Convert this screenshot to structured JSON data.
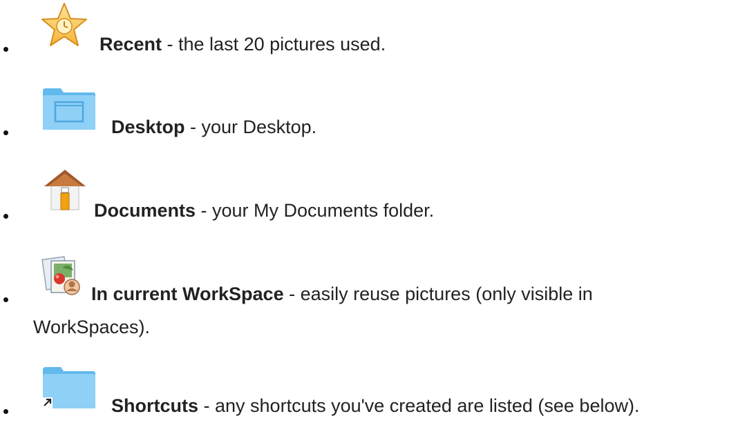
{
  "list": {
    "items": [
      {
        "icon": "recent-star-icon",
        "label": "Recent",
        "description": " - the last 20 pictures used."
      },
      {
        "icon": "desktop-folder-icon",
        "label": "Desktop",
        "description": " - your Desktop."
      },
      {
        "icon": "home-icon",
        "label": "Documents",
        "description": " - your My Documents folder."
      },
      {
        "icon": "workspace-pictures-icon",
        "label": "In current WorkSpace",
        "description": " - easily reuse pictures (only visible in",
        "description_line2": "WorkSpaces)."
      },
      {
        "icon": "shortcut-folder-icon",
        "label": "Shortcuts",
        "description": " - any shortcuts you've created are listed (see below)."
      }
    ]
  }
}
